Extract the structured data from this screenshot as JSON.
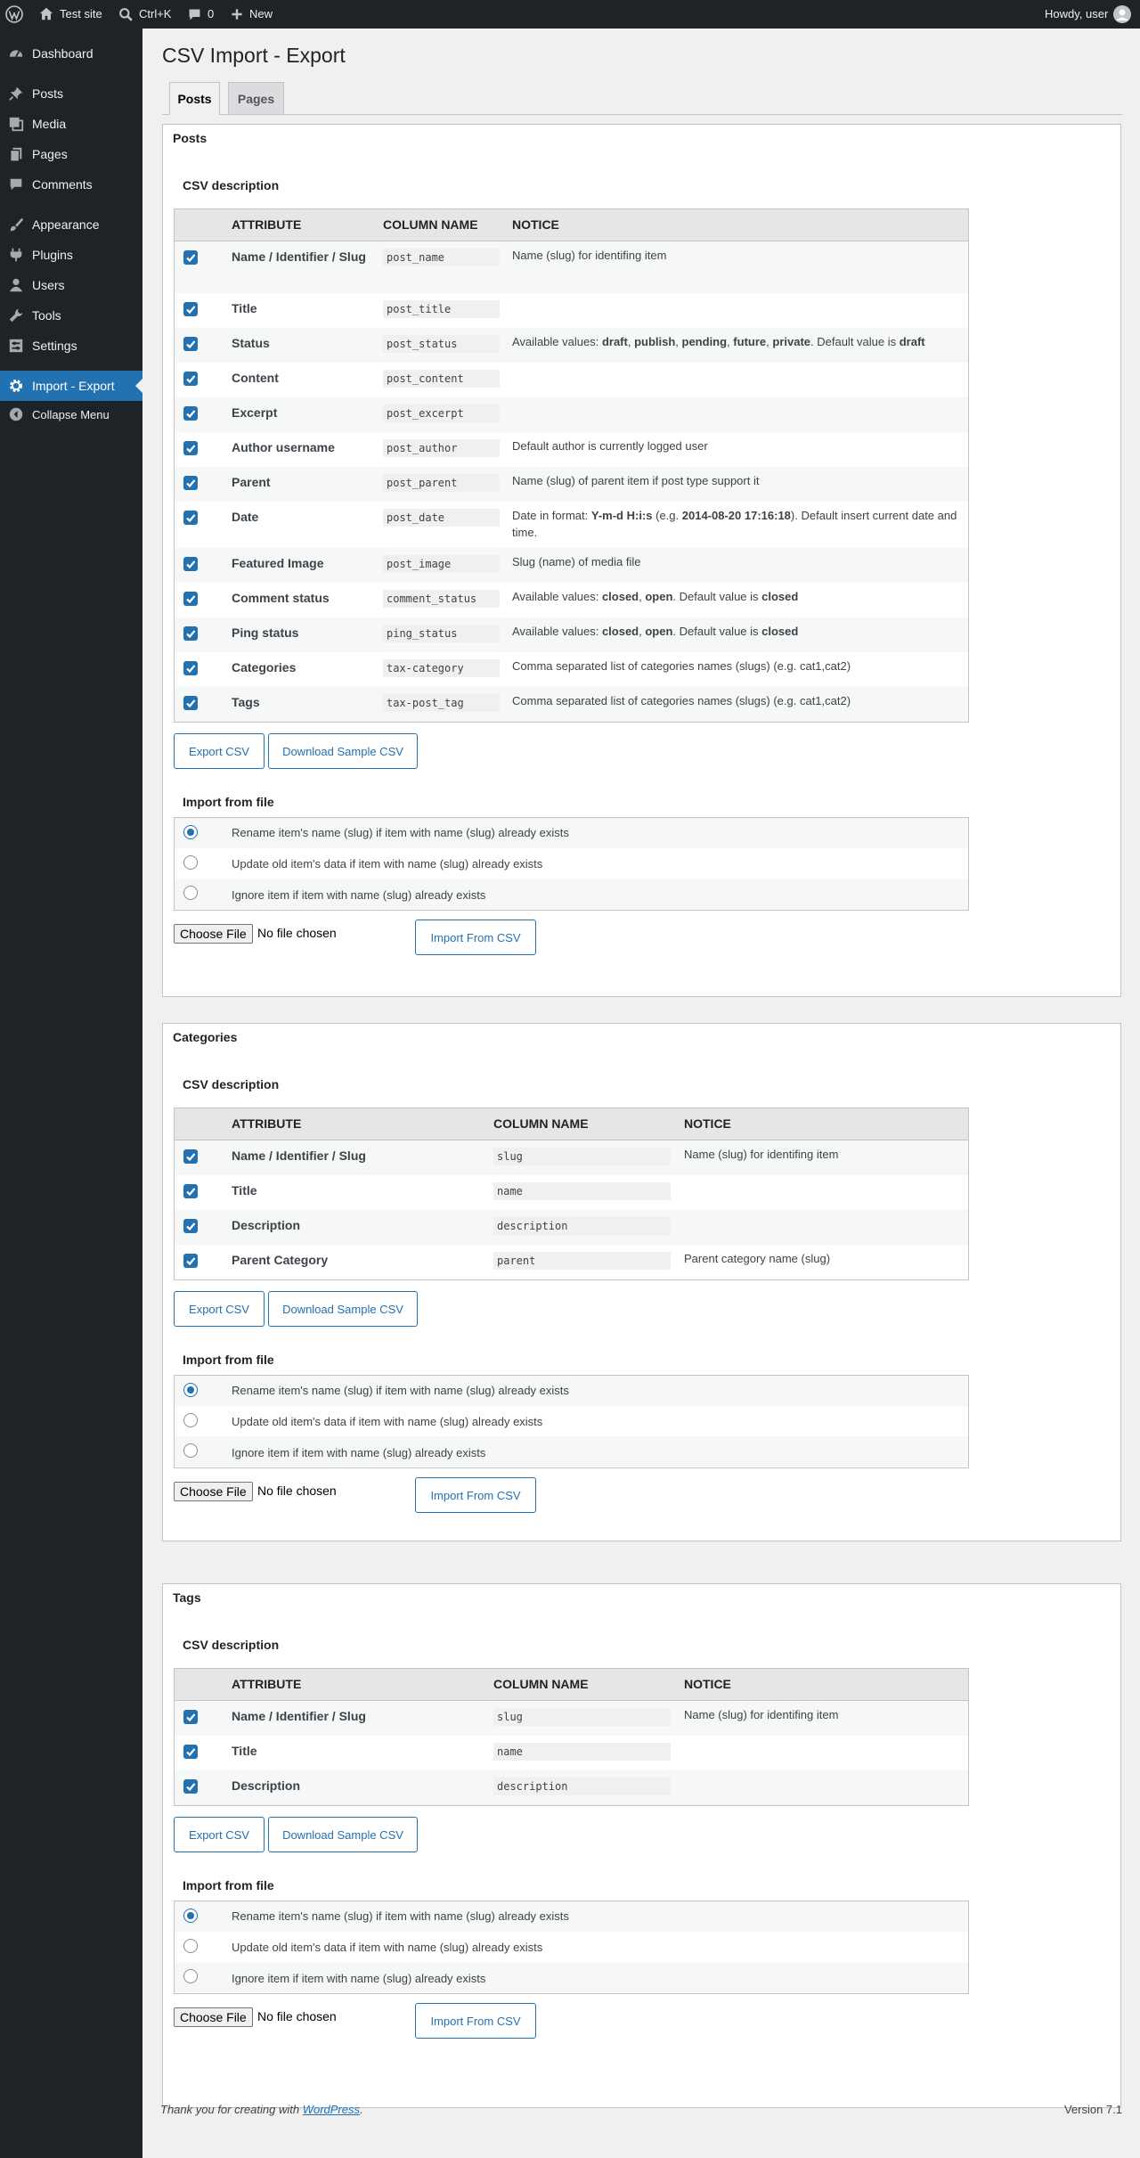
{
  "admin_bar": {
    "site_name": "Test site",
    "search_shortcut": "Ctrl+K",
    "comments_count": "0",
    "new_label": "New",
    "howdy": "Howdy, user"
  },
  "menu": {
    "items": [
      {
        "label": "Dashboard",
        "icon": "dashboard-icon"
      },
      {
        "label": "Posts",
        "icon": "pin-icon"
      },
      {
        "label": "Media",
        "icon": "media-icon"
      },
      {
        "label": "Pages",
        "icon": "pages-icon"
      },
      {
        "label": "Comments",
        "icon": "comment-icon"
      },
      {
        "label": "Appearance",
        "icon": "brush-icon"
      },
      {
        "label": "Plugins",
        "icon": "plugin-icon"
      },
      {
        "label": "Users",
        "icon": "user-icon"
      },
      {
        "label": "Tools",
        "icon": "wrench-icon"
      },
      {
        "label": "Settings",
        "icon": "settings-icon"
      },
      {
        "label": "Import - Export",
        "icon": "gear-icon",
        "current": true
      },
      {
        "label": "Collapse Menu",
        "icon": "collapse-icon"
      }
    ]
  },
  "page": {
    "title": "CSV Import - Export",
    "tabs": [
      "Posts",
      "Pages"
    ]
  },
  "labels": {
    "csv_description": "CSV description",
    "import_from_file": "Import from file",
    "col_attribute": "ATTRIBUTE",
    "col_column_name": "COLUMN NAME",
    "col_notice": "NOTICE",
    "export_csv": "Export CSV",
    "download_sample": "Download Sample CSV",
    "import_from_csv": "Import From CSV",
    "choose_file": "Choose File",
    "no_file": "No file chosen",
    "radio_rename": "Rename item's name (slug) if item with name (slug) already exists",
    "radio_update": "Update old item's data if item with name (slug) already exists",
    "radio_ignore": "Ignore item if item with name (slug) already exists"
  },
  "sections": [
    {
      "title": "Posts",
      "rows": [
        {
          "attr": "Name / Identifier / Slug",
          "col": "post_name",
          "notice": "Name (slug) for identifing item"
        },
        {
          "attr": "Title",
          "col": "post_title",
          "notice": ""
        },
        {
          "attr": "Status",
          "col": "post_status",
          "notice": "Available values: <b>draft</b>, <b>publish</b>, <b>pending</b>, <b>future</b>, <b>private</b>. Default value is <b>draft</b>"
        },
        {
          "attr": "Content",
          "col": "post_content",
          "notice": ""
        },
        {
          "attr": "Excerpt",
          "col": "post_excerpt",
          "notice": ""
        },
        {
          "attr": "Author username",
          "col": "post_author",
          "notice": "Default author is currently logged user"
        },
        {
          "attr": "Parent",
          "col": "post_parent",
          "notice": "Name (slug) of parent item if post type support it"
        },
        {
          "attr": "Date",
          "col": "post_date",
          "notice": "Date in format: <b>Y-m-d H:i:s</b> (e.g. <b>2014-08-20 17:16:18</b>). Default insert current date and time."
        },
        {
          "attr": "Featured Image",
          "col": "post_image",
          "notice": "Slug (name) of media file"
        },
        {
          "attr": "Comment status",
          "col": "comment_status",
          "notice": "Available values: <b>closed</b>, <b>open</b>. Default value is <b>closed</b>"
        },
        {
          "attr": "Ping status",
          "col": "ping_status",
          "notice": "Available values: <b>closed</b>, <b>open</b>. Default value is <b>closed</b>"
        },
        {
          "attr": "Categories",
          "col": "tax-category",
          "notice": "Comma separated list of categories names (slugs) (e.g. cat1,cat2)"
        },
        {
          "attr": "Tags",
          "col": "tax-post_tag",
          "notice": "Comma separated list of categories names (slugs) (e.g. cat1,cat2)"
        }
      ]
    },
    {
      "title": "Categories",
      "rows": [
        {
          "attr": "Name / Identifier / Slug",
          "col": "slug",
          "notice": "Name (slug) for identifing item"
        },
        {
          "attr": "Title",
          "col": "name",
          "notice": ""
        },
        {
          "attr": "Description",
          "col": "description",
          "notice": ""
        },
        {
          "attr": "Parent Category",
          "col": "parent",
          "notice": "Parent category name (slug)"
        }
      ]
    },
    {
      "title": "Tags",
      "rows": [
        {
          "attr": "Name / Identifier / Slug",
          "col": "slug",
          "notice": "Name (slug) for identifing item"
        },
        {
          "attr": "Title",
          "col": "name",
          "notice": ""
        },
        {
          "attr": "Description",
          "col": "description",
          "notice": ""
        }
      ]
    }
  ],
  "footer": {
    "thanks_prefix": "Thank you for creating with ",
    "thanks_link": "WordPress",
    "thanks_suffix": ".",
    "version": "Version 7.1"
  },
  "colors": {
    "accent": "#2271b1",
    "admin_dark": "#1d2327",
    "background": "#f0f0f1"
  }
}
